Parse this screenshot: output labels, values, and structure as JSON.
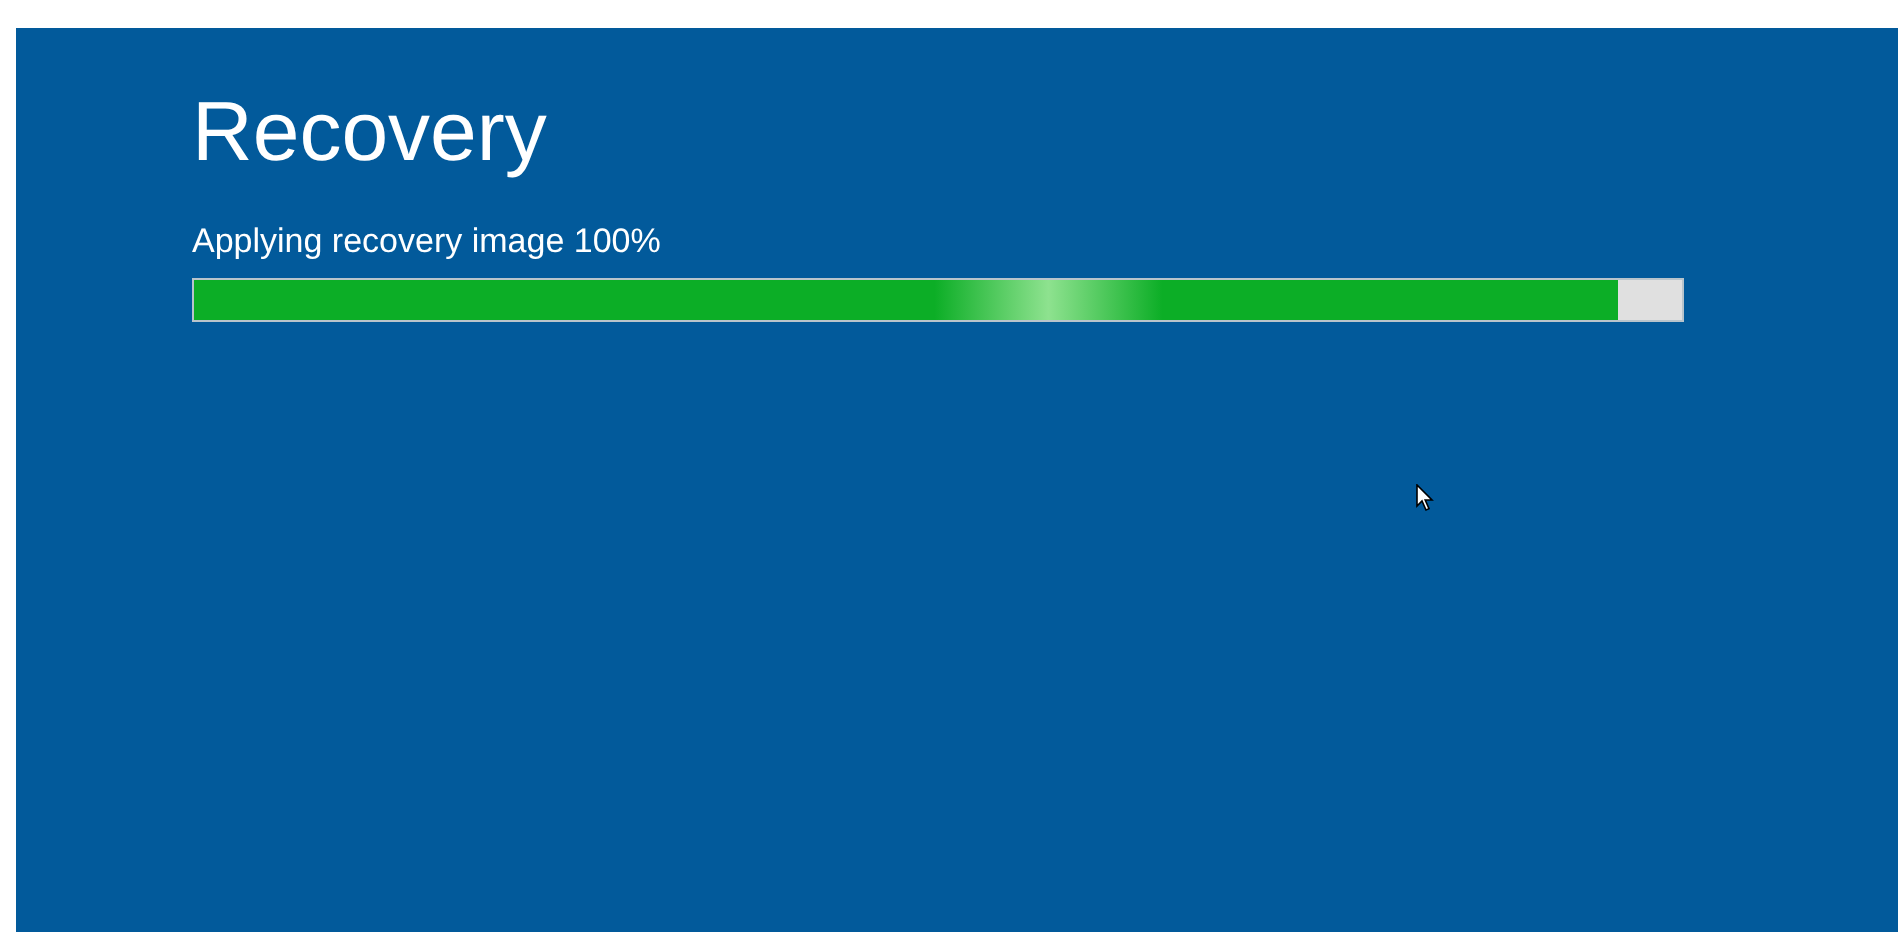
{
  "title": "Recovery",
  "progress": {
    "label": "Applying recovery image 100%",
    "level": 0.957
  }
}
